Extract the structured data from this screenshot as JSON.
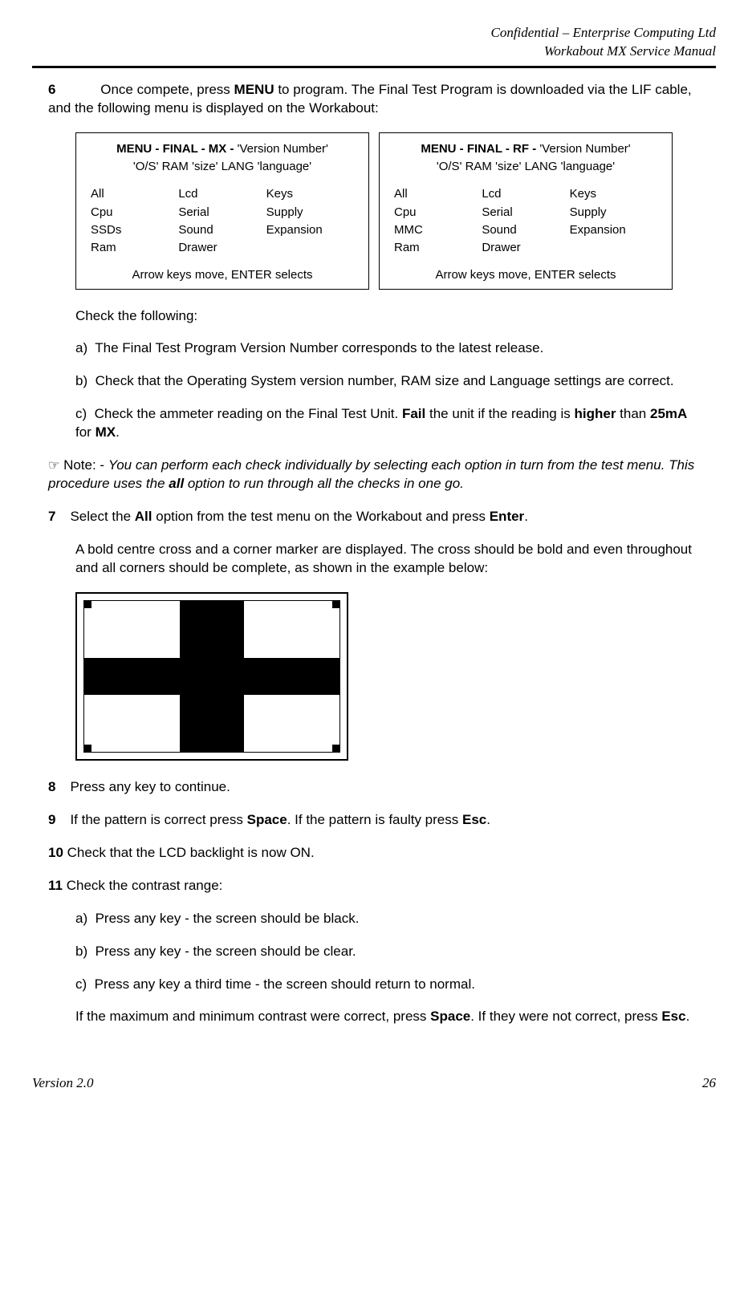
{
  "header": {
    "line1": "Confidential – Enterprise Computing Ltd",
    "line2": "Workabout MX Service Manual"
  },
  "step6": {
    "num": "6",
    "text_before_menu": "Once compete, press ",
    "menu_word": "MENU",
    "text_after_menu": " to program. The Final Test Program is downloaded via the LIF cable, and the following menu is displayed on the Workabout:"
  },
  "menu_mx": {
    "title_bold": "MENU - FINAL - MX -",
    "title_rest": " 'Version Number'",
    "sub": "'O/S'  RAM 'size'  LANG 'language'",
    "items": [
      "All",
      "Lcd",
      "Keys",
      "Cpu",
      "Serial",
      "Supply",
      "SSDs",
      "Sound",
      "Expansion",
      "Ram",
      "Drawer",
      ""
    ],
    "foot": "Arrow keys move, ENTER selects"
  },
  "menu_rf": {
    "title_bold": "MENU - FINAL - RF -",
    "title_rest": " 'Version Number'",
    "sub": "'O/S'  RAM 'size'  LANG 'language'",
    "items": [
      "All",
      "Lcd",
      "Keys",
      "Cpu",
      "Serial",
      "Supply",
      "MMC",
      "Sound",
      "Expansion",
      "Ram",
      "Drawer",
      ""
    ],
    "foot": "Arrow keys move, ENTER selects"
  },
  "check_intro": "Check the following:",
  "check_a": {
    "label": "a)",
    "text": "The Final Test Program Version Number corresponds to the latest release."
  },
  "check_b": {
    "label": "b)",
    "text": "Check that the Operating System version number, RAM size and Language settings are correct."
  },
  "check_c": {
    "label": "c)",
    "t1": "Check the ammeter reading on the Final Test Unit. ",
    "fail": "Fail",
    "t2": " the unit if the reading is ",
    "higher": "higher",
    "t3": " than ",
    "ma": "25mA",
    "t4": " for ",
    "mx": "MX",
    "t5": "."
  },
  "note": {
    "icon": "☞",
    "pre": " Note: - ",
    "i1": "You can perform each check individually by selecting each option in turn from the test menu. This procedure uses the ",
    "all": "all",
    "i2": " option to run through all the checks in one go."
  },
  "step7": {
    "num": "7",
    "t1": "Select the ",
    "all": "All",
    "t2": " option from the test menu on the Workabout and press ",
    "enter": "Enter",
    "t3": ".",
    "para2": "A bold centre cross and a corner marker are displayed. The cross should be bold and even throughout and all corners should be complete, as shown in the example below:"
  },
  "step8": {
    "num": "8",
    "text": "Press any key to continue."
  },
  "step9": {
    "num": "9",
    "t1": "If the pattern is correct press ",
    "space": "Space",
    "t2": ". If the pattern is faulty press ",
    "esc": "Esc",
    "t3": "."
  },
  "step10": {
    "num": "10",
    "text": "Check that the LCD backlight is now ON."
  },
  "step11": {
    "num": "11",
    "intro": "Check the contrast range:",
    "a": {
      "label": "a)",
      "text": "Press any key - the screen should be black."
    },
    "b": {
      "label": "b)",
      "text": "Press any key - the screen should be clear."
    },
    "c": {
      "label": "c)",
      "text": "Press any key a third time - the screen should return to normal."
    },
    "final_t1": "If the maximum and minimum contrast were correct, press ",
    "space": "Space",
    "final_t2": ". If they were not correct, press ",
    "esc": "Esc",
    "final_t3": "."
  },
  "footer": {
    "version": "Version 2.0",
    "page": "26"
  }
}
